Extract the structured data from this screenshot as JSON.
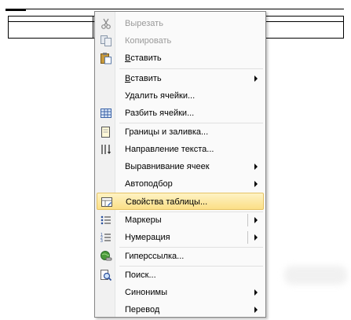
{
  "menu": {
    "items": [
      {
        "label": "Вырезать",
        "disabled": true,
        "icon": "scissors-icon"
      },
      {
        "label": "Копировать",
        "disabled": true,
        "icon": "copy-icon"
      },
      {
        "label": "Вставить",
        "disabled": false,
        "icon": "paste-icon"
      },
      {
        "label": "Вставить",
        "disabled": false,
        "submenu": true
      },
      {
        "label": "Удалить ячейки...",
        "disabled": false
      },
      {
        "label": "Разбить ячейки...",
        "disabled": false,
        "icon": "split-cells-icon"
      },
      {
        "label": "Границы и заливка...",
        "disabled": false,
        "icon": "borders-icon"
      },
      {
        "label": "Направление текста...",
        "disabled": false,
        "icon": "text-direction-icon"
      },
      {
        "label": "Выравнивание ячеек",
        "disabled": false,
        "submenu": true
      },
      {
        "label": "Автоподбор",
        "disabled": false,
        "submenu": true
      },
      {
        "label": "Свойства таблицы...",
        "disabled": false,
        "icon": "table-properties-icon",
        "highlighted": true
      },
      {
        "label": "Маркеры",
        "disabled": false,
        "icon": "bullets-icon",
        "submenu": true,
        "split": true
      },
      {
        "label": "Нумерация",
        "disabled": false,
        "icon": "numbering-icon",
        "submenu": true,
        "split": true
      },
      {
        "label": "Гиперссылка...",
        "disabled": false,
        "icon": "hyperlink-icon"
      },
      {
        "label": "Поиск...",
        "disabled": false,
        "icon": "research-icon"
      },
      {
        "label": "Синонимы",
        "disabled": false,
        "submenu": true
      },
      {
        "label": "Перевод",
        "disabled": false,
        "submenu": true
      }
    ]
  },
  "colors": {
    "highlight_top": "#fef3c4",
    "highlight_bottom": "#fbdf86",
    "disabled_text": "#9a9a9a"
  }
}
